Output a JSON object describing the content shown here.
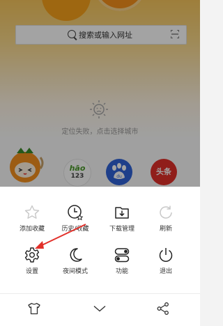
{
  "search": {
    "placeholder": "搜索或输入网址"
  },
  "weather": {
    "message": "定位失败，点击选择城市"
  },
  "shortcuts": [
    {
      "name": "mascot"
    },
    {
      "name": "hao123",
      "line1": "hāo",
      "line2": "123"
    },
    {
      "name": "baidu",
      "text": "du"
    },
    {
      "name": "toutiao",
      "text": "头条"
    }
  ],
  "menu": {
    "items": [
      {
        "label": "添加收藏",
        "icon": "star-icon"
      },
      {
        "label": "历史/收藏",
        "icon": "history-icon"
      },
      {
        "label": "下载管理",
        "icon": "download-folder-icon"
      },
      {
        "label": "刷新",
        "icon": "refresh-icon"
      },
      {
        "label": "设置",
        "icon": "gear-icon"
      },
      {
        "label": "夜间模式",
        "icon": "moon-icon"
      },
      {
        "label": "功能",
        "icon": "toggles-icon"
      },
      {
        "label": "退出",
        "icon": "power-icon"
      }
    ]
  },
  "toolbar": {
    "icons": [
      "shirt-icon",
      "chevron-down-icon",
      "share-icon"
    ]
  },
  "colors": {
    "accent": "#e2302a",
    "dim": "rgba(0,0,0,0.36)"
  }
}
